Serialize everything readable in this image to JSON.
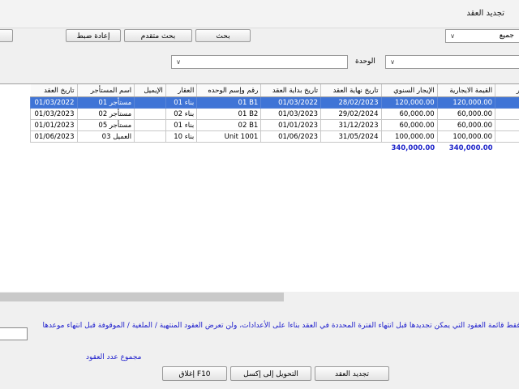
{
  "window": {
    "title": "تجديد العقد"
  },
  "toolbar": {
    "reset_label": "إعادة ضبط",
    "advanced_search_label": "بحث متقدم",
    "search_label": "بحث"
  },
  "filters": {
    "status_value": "جميع",
    "unit_label": "الوحدة",
    "unit_value": "",
    "property_value": ""
  },
  "table": {
    "columns": [
      "طة للإنجار",
      "القيمة الايجارية",
      "الإيجار السنوي",
      "تاريخ نهاية العقد",
      "تاريخ بداية العقد",
      "رقم وإسم الوحده",
      "العقار",
      "الإيميل",
      "اسم المستأجر",
      "تاريخ العقد"
    ],
    "rows": [
      {
        "cells": [
          "",
          "120,000.00",
          "120,000.00",
          "28/02/2023",
          "01/03/2022",
          "01 B1",
          "بناء 01",
          "",
          "مستأجر 01",
          "01/03/2022"
        ],
        "selected": true
      },
      {
        "cells": [
          "",
          "60,000.00",
          "60,000.00",
          "29/02/2024",
          "01/03/2023",
          "01 B2",
          "بناء 02",
          "",
          "مستأجر 02",
          "01/03/2023"
        ],
        "selected": false
      },
      {
        "cells": [
          "",
          "60,000.00",
          "60,000.00",
          "31/12/2023",
          "01/01/2023",
          "02 B1",
          "بناء 01",
          "",
          "مستأجر 05",
          "01/01/2023"
        ],
        "selected": false
      },
      {
        "cells": [
          "",
          "100,000.00",
          "100,000.00",
          "31/05/2024",
          "01/06/2023",
          "Unit 1001",
          "بناء 10",
          "",
          "العميل 03",
          "01/06/2023"
        ],
        "selected": false
      }
    ],
    "totals": {
      "rental_value": "340,000.00",
      "annual_rent": "340,000.00"
    }
  },
  "note": "بر فقط قائمة العقود التي يمكن تجديدها قبل انتهاء الفترة المحددة في العقد بناءا على الأعدادات، ولن تعرض العقود المنتهية / الملغية / الموقوفة قبل انتهاء موعدها",
  "footer": {
    "count_label": "مجموع عدد العقود",
    "count_value": "",
    "renew_label": "تجديد العقد",
    "export_label": "التحويل إلى إكسل",
    "close_label": "إغلاق F10"
  }
}
